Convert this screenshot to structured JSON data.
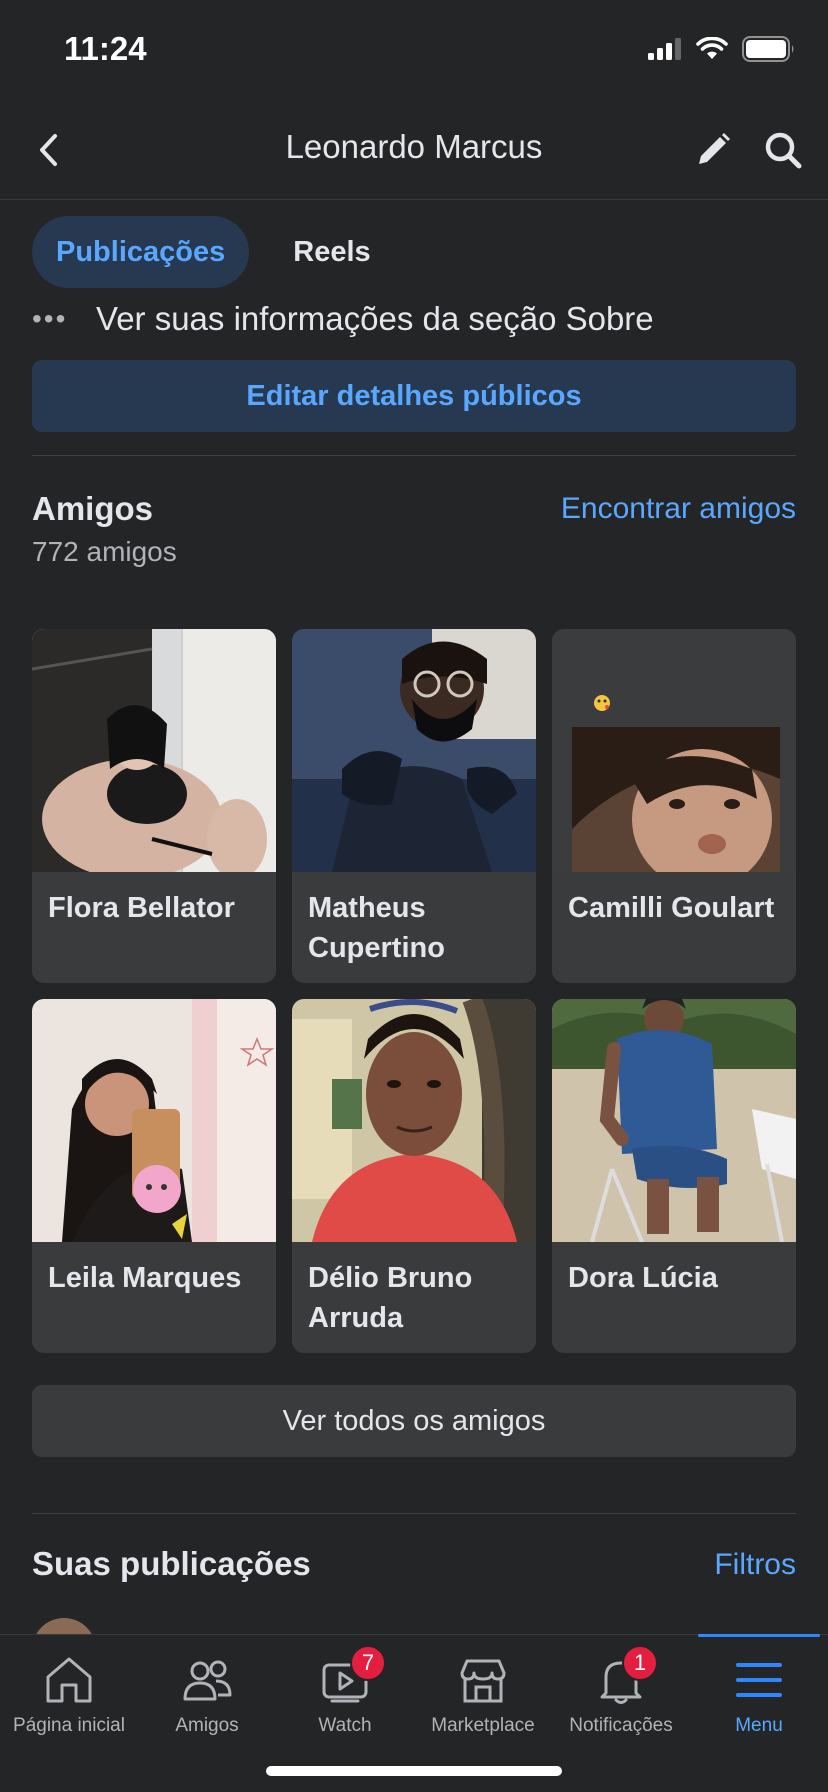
{
  "status": {
    "time": "11:24"
  },
  "header": {
    "title": "Leonardo Marcus"
  },
  "tabs": [
    {
      "label": "Publicações",
      "active": true
    },
    {
      "label": "Reels",
      "active": false
    }
  ],
  "about": {
    "text": "Ver suas informações da seção Sobre"
  },
  "edit_public_button": "Editar detalhes públicos",
  "friends": {
    "title": "Amigos",
    "count": "772 amigos",
    "find_link": "Encontrar amigos",
    "items": [
      {
        "name": "Flora Bellator"
      },
      {
        "name": "Matheus Cupertino"
      },
      {
        "name": "Camilli Goulart"
      },
      {
        "name": "Leila Marques"
      },
      {
        "name": "Délio Bruno Arruda"
      },
      {
        "name": "Dora Lúcia"
      }
    ],
    "see_all": "Ver todos os amigos"
  },
  "posts": {
    "title": "Suas publicações",
    "filters": "Filtros"
  },
  "tab_bar": {
    "items": [
      {
        "label": "Página inicial",
        "icon": "home-icon"
      },
      {
        "label": "Amigos",
        "icon": "friends-icon"
      },
      {
        "label": "Watch",
        "icon": "watch-icon",
        "badge": "7"
      },
      {
        "label": "Marketplace",
        "icon": "marketplace-icon"
      },
      {
        "label": "Notificações",
        "icon": "bell-icon",
        "badge": "1"
      },
      {
        "label": "Menu",
        "icon": "menu-icon",
        "active": true
      }
    ]
  },
  "colors": {
    "background": "#242526",
    "accent": "#5aa7ff",
    "accent_bg": "#263951",
    "card": "#3a3b3c",
    "badge": "#e41e3f"
  }
}
